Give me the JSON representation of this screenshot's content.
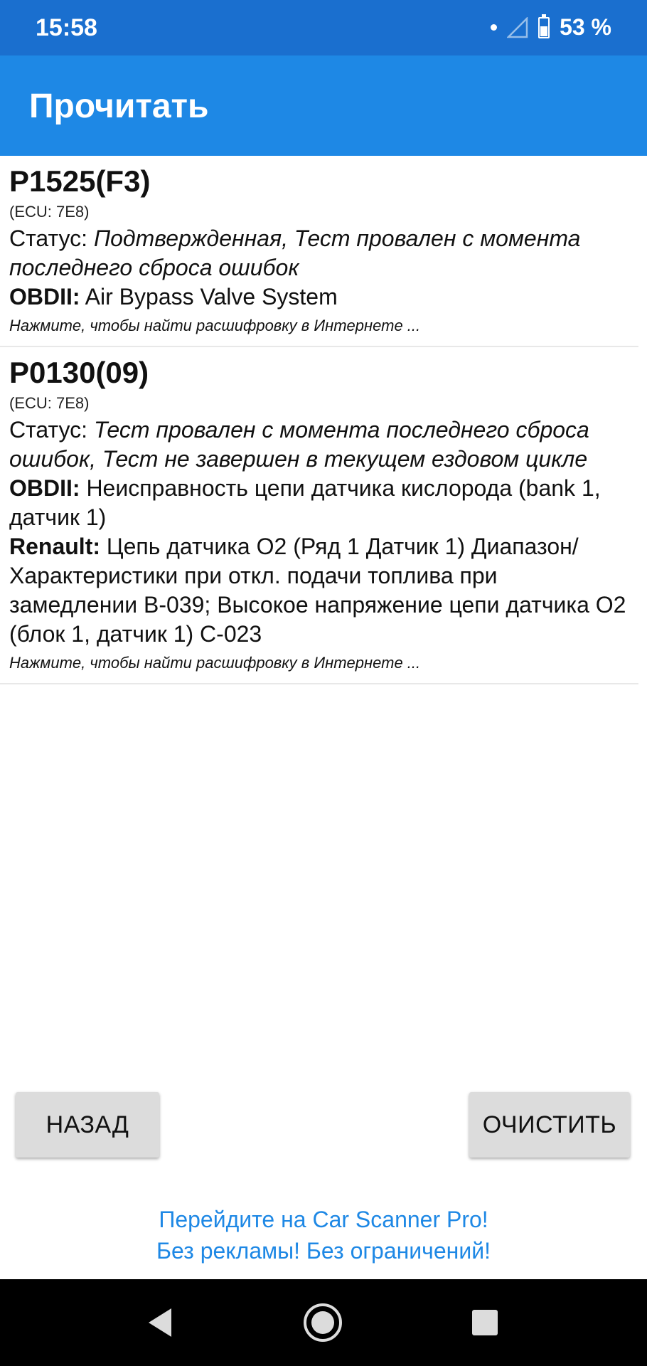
{
  "status_bar": {
    "time": "15:58",
    "battery": "53 %",
    "battery_level": 0.53,
    "icons": [
      "notification-dot-icon",
      "signal-icon",
      "battery-icon"
    ]
  },
  "app_bar": {
    "title": "Прочитать"
  },
  "dtc_list": [
    {
      "code": "P1525(F3)",
      "ecu": "(ECU: 7E8)",
      "status_label": "Статус: ",
      "status_value": "Подтвержденная, Тест провален с момента последнего сброса ошибок",
      "descriptions": [
        {
          "label": "OBDII:",
          "text": " Air Bypass Valve System"
        }
      ],
      "link": "Нажмите, чтобы найти расшифровку в Интернете ..."
    },
    {
      "code": "P0130(09)",
      "ecu": "(ECU: 7E8)",
      "status_label": "Статус: ",
      "status_value": "Тест провален с момента последнего сброса ошибок, Тест не завершен в текущем ездовом цикле",
      "descriptions": [
        {
          "label": "OBDII:",
          "text": " Неисправность цепи датчика кислорода (bank 1, датчик 1)"
        },
        {
          "label": "Renault:",
          "text": " Цепь датчика O2 (Ряд 1 Датчик 1) Диапазон/Характеристики при откл. подачи топлива при замедлении B-039; Высокое напряжение цепи датчика O2 (блок 1, датчик 1) C-023"
        }
      ],
      "link": "Нажмите, чтобы найти расшифровку в Интернете ..."
    }
  ],
  "buttons": {
    "back": "НАЗАД",
    "clear": "ОЧИСТИТЬ"
  },
  "promo": {
    "line1": "Перейдите на Car Scanner Pro!",
    "line2": "Без рекламы! Без ограничений!"
  },
  "nav_bar": {
    "icons": [
      "back-icon",
      "home-icon",
      "recent-apps-icon"
    ]
  },
  "colors": {
    "status_bar": "#1a6fcf",
    "app_bar": "#1e88e5",
    "promo_text": "#1e88e5",
    "button_bg": "#dcdcdc"
  }
}
